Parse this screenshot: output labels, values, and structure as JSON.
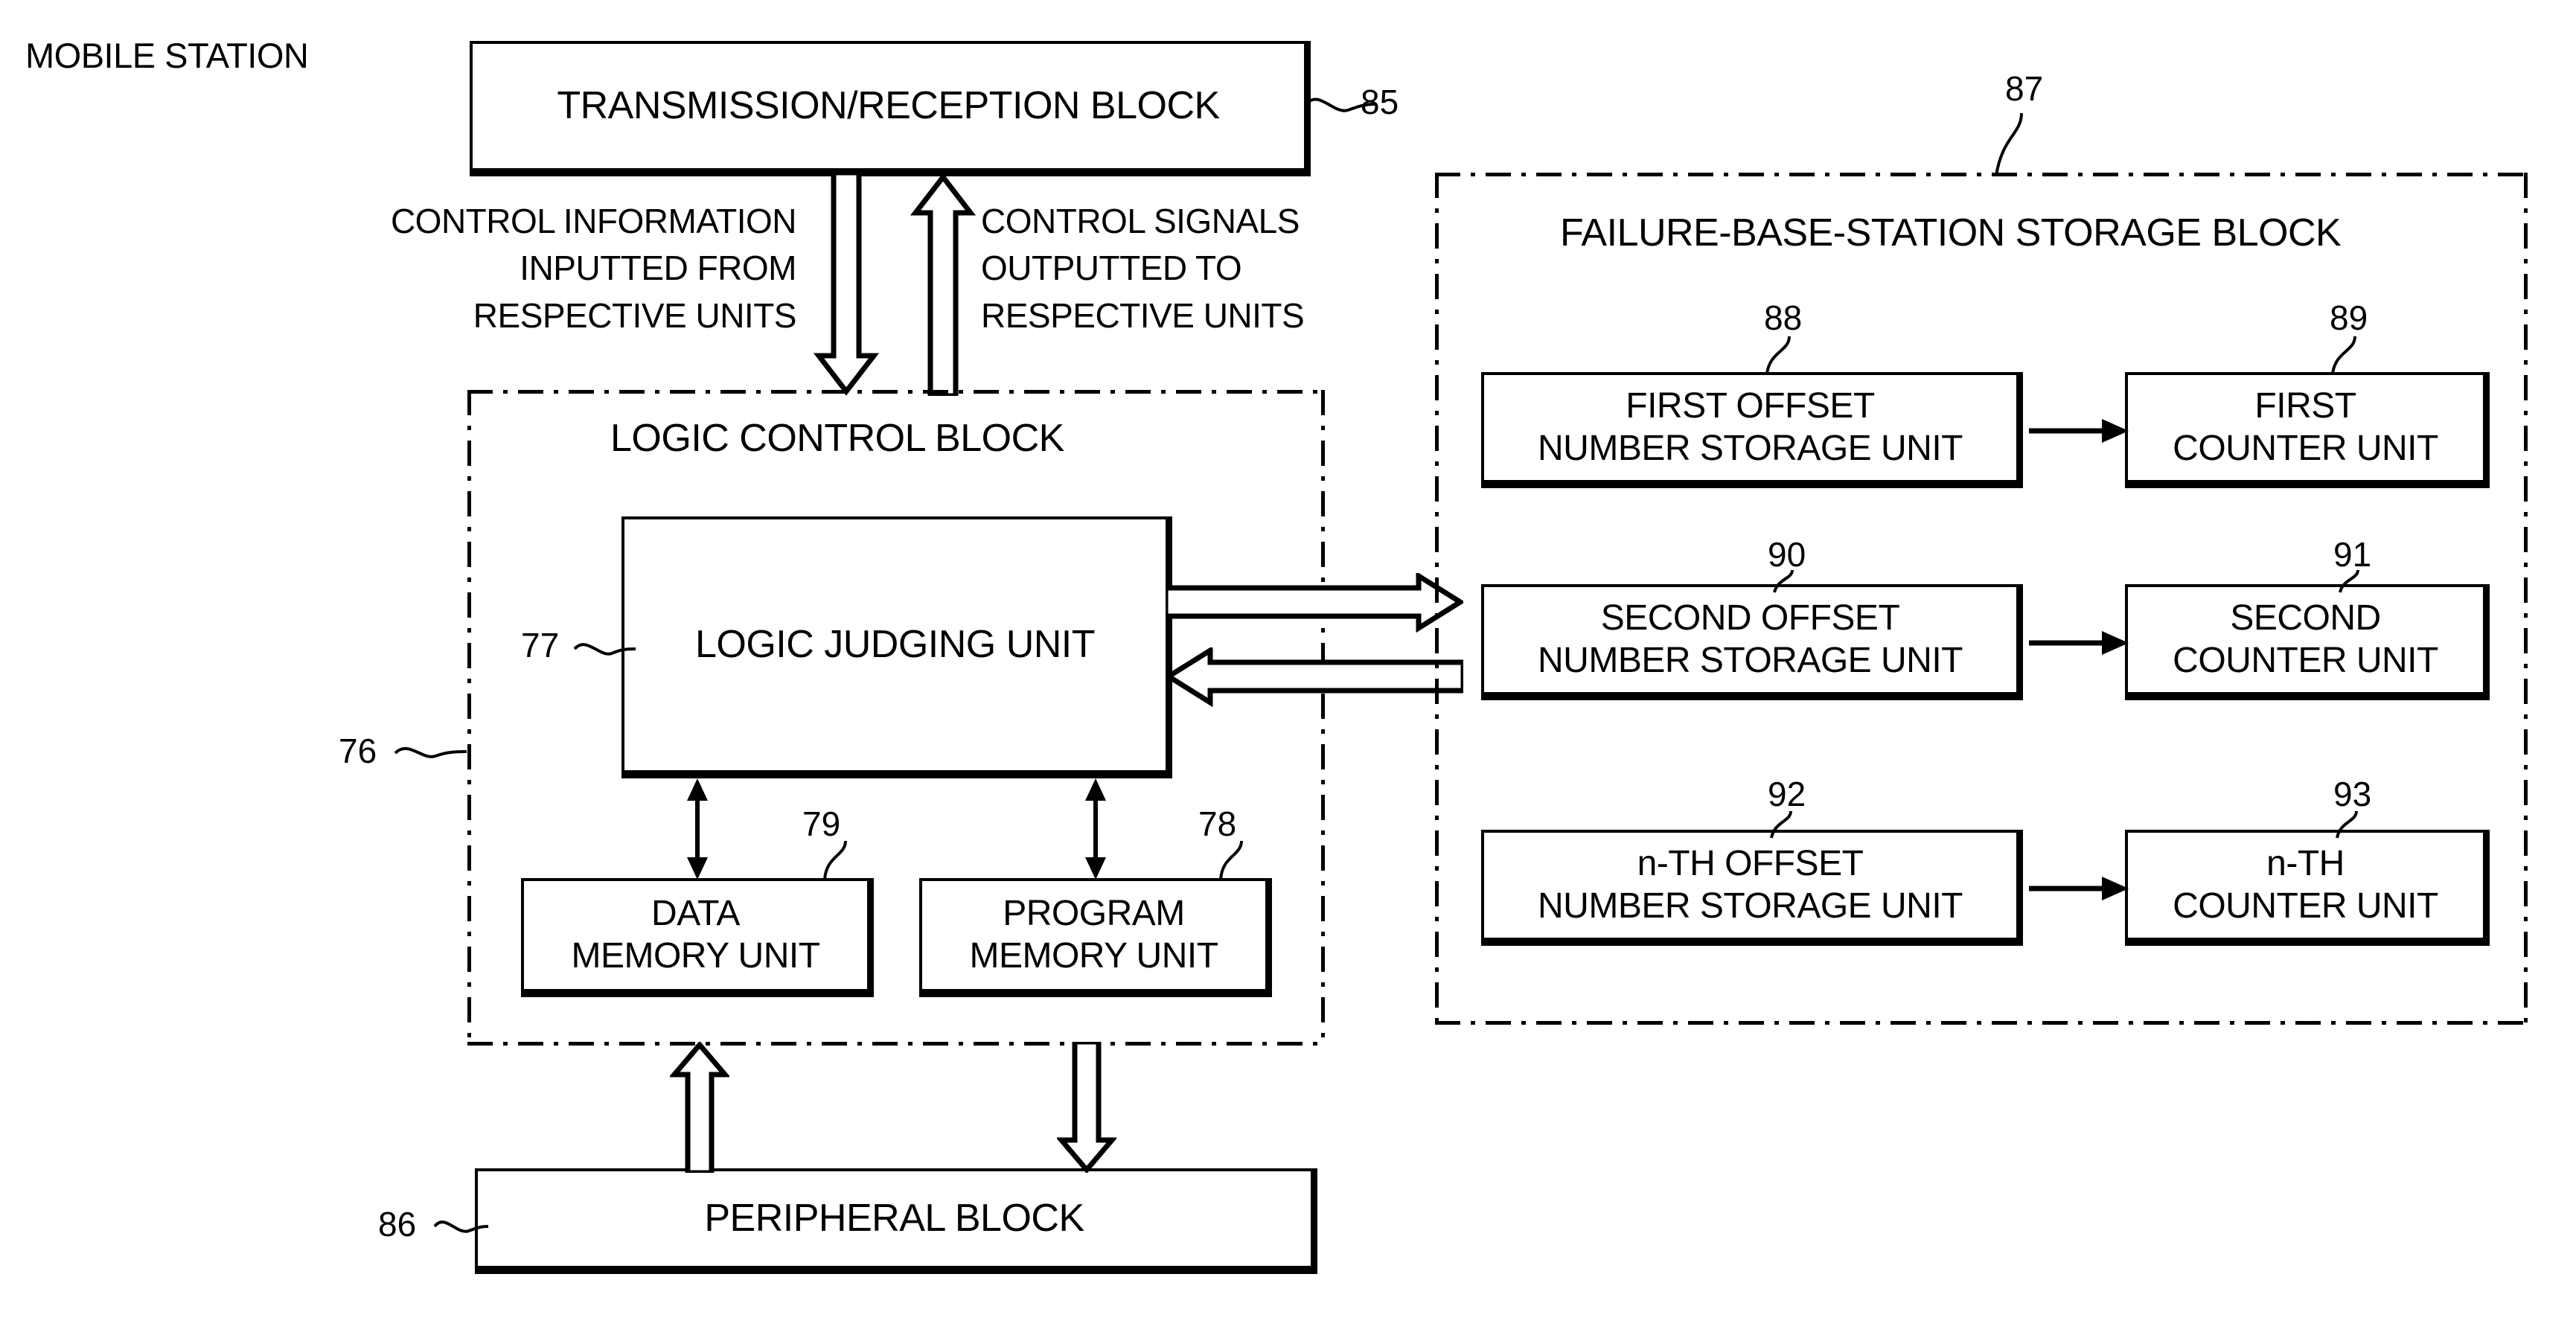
{
  "figure": {
    "caption_left": "MOBILE STATION"
  },
  "blocks": {
    "transmission": {
      "label": "TRANSMISSION/RECEPTION BLOCK",
      "ref": "85"
    },
    "logic_control": {
      "label": "LOGIC CONTROL BLOCK",
      "ref": "76"
    },
    "logic_judging": {
      "label": "LOGIC JUDGING UNIT",
      "ref": "77"
    },
    "data_memory": {
      "label_line1": "DATA",
      "label_line2": "MEMORY UNIT",
      "ref": "79"
    },
    "program_memory": {
      "label_line1": "PROGRAM",
      "label_line2": "MEMORY UNIT",
      "ref": "78"
    },
    "peripheral": {
      "label": "PERIPHERAL BLOCK",
      "ref": "86"
    },
    "failure_storage": {
      "label": "FAILURE-BASE-STATION STORAGE BLOCK",
      "ref": "87"
    }
  },
  "storage_rows": [
    {
      "offset": {
        "line1": "FIRST OFFSET",
        "line2": "NUMBER STORAGE UNIT",
        "ref": "88"
      },
      "counter": {
        "line1": "FIRST",
        "line2": "COUNTER UNIT",
        "ref": "89"
      }
    },
    {
      "offset": {
        "line1": "SECOND OFFSET",
        "line2": "NUMBER STORAGE UNIT",
        "ref": "90"
      },
      "counter": {
        "line1": "SECOND",
        "line2": "COUNTER UNIT",
        "ref": "91"
      }
    },
    {
      "offset": {
        "line1": "n-TH OFFSET",
        "line2": "NUMBER STORAGE UNIT",
        "ref": "92"
      },
      "counter": {
        "line1": "n-TH",
        "line2": "COUNTER UNIT",
        "ref": "93"
      }
    }
  ],
  "annotations": {
    "control_information": {
      "line1": "CONTROL INFORMATION",
      "line2": "INPUTTED FROM",
      "line3": "RESPECTIVE UNITS"
    },
    "control_signals": {
      "line1": "CONTROL SIGNALS",
      "line2": "OUTPUTTED TO",
      "line3": "RESPECTIVE UNITS"
    }
  },
  "colors": {
    "ink": "#000000",
    "paper": "#ffffff"
  }
}
